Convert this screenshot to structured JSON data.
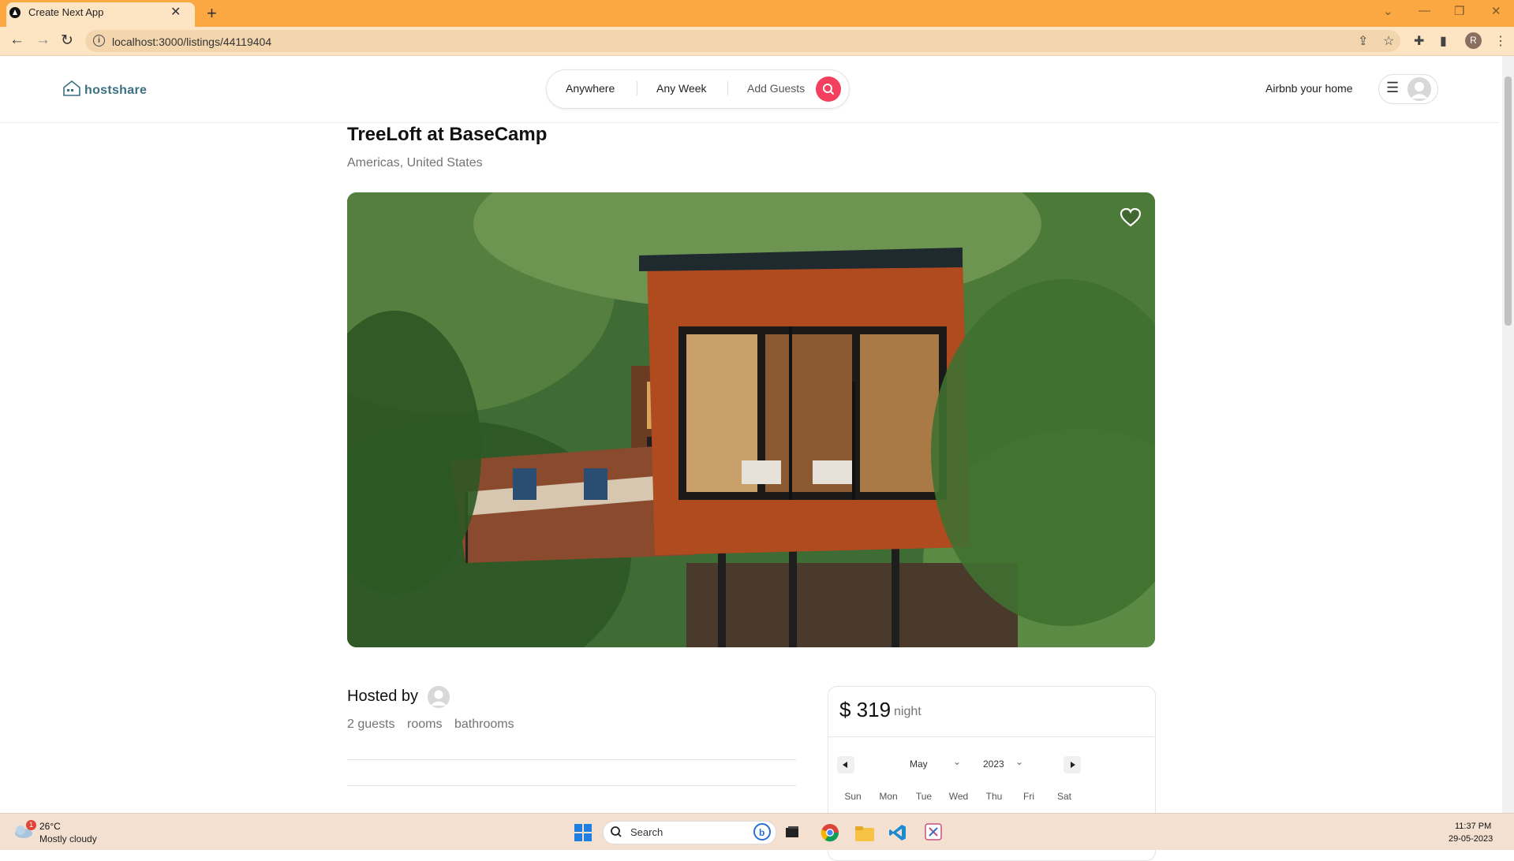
{
  "browser": {
    "tab_title": "Create Next App",
    "url": "localhost:3000/listings/44119404",
    "profile_initial": "R"
  },
  "header": {
    "logo_text": "hostshare",
    "search": {
      "where": "Anywhere",
      "when": "Any Week",
      "guests": "Add Guests"
    },
    "host_link": "Airbnb your home"
  },
  "listing": {
    "title": "TreeLoft at BaseCamp",
    "location": "Americas, United States",
    "hosted_by": "Hosted by",
    "stats": {
      "guests": "2 guests",
      "rooms": "rooms",
      "bathrooms": "bathrooms"
    }
  },
  "booking": {
    "price": "$ 319",
    "unit": "night",
    "month": "May",
    "year": "2023",
    "weekdays": [
      "Sun",
      "Mon",
      "Tue",
      "Wed",
      "Thu",
      "Fri",
      "Sat"
    ]
  },
  "taskbar": {
    "weather_temp": "26°C",
    "weather_desc": "Mostly cloudy",
    "weather_badge": "1",
    "search_label": "Search",
    "time": "11:37 PM",
    "date": "29-05-2023"
  },
  "colors": {
    "accent": "#f43f5e",
    "titlebar": "#fba843",
    "toolbar": "#fde5c4",
    "logo": "#3b6f82"
  }
}
